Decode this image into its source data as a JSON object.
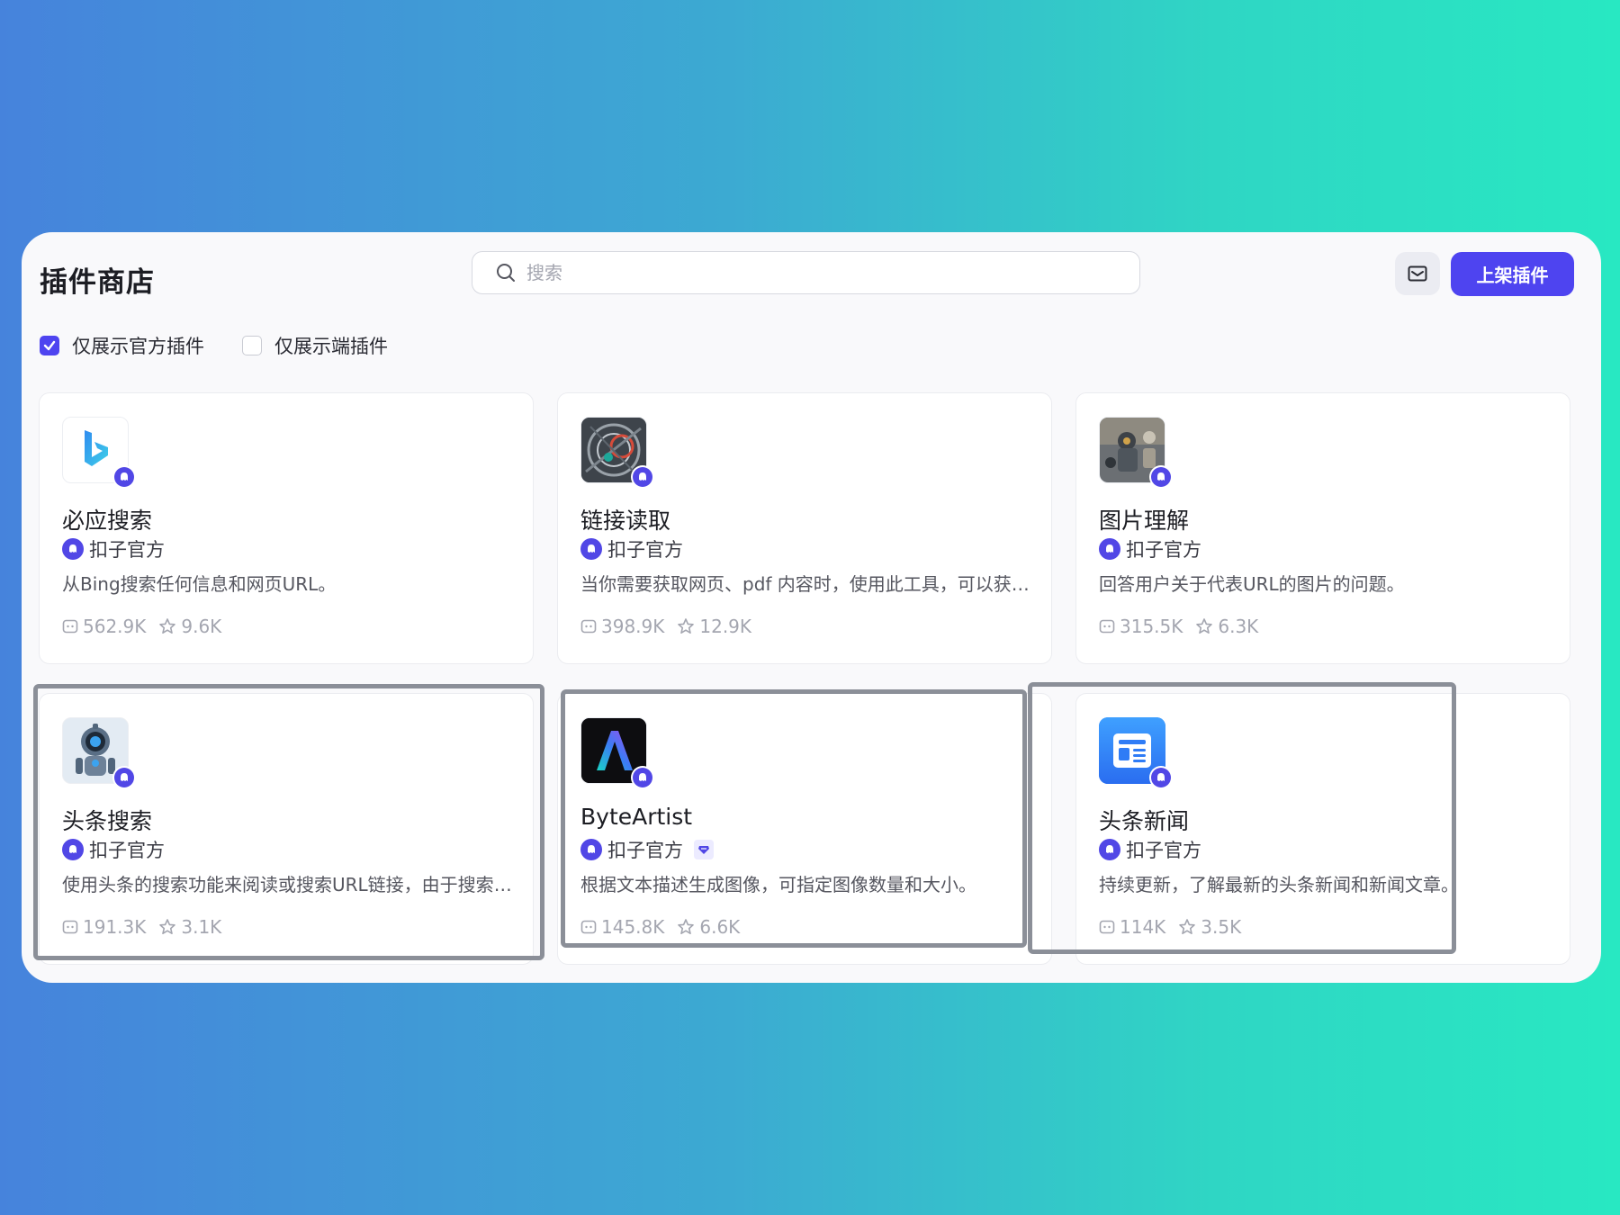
{
  "header": {
    "title": "插件商店",
    "search_placeholder": "搜索",
    "search_value": "",
    "publish_label": "上架插件"
  },
  "filters": [
    {
      "label": "仅展示官方插件",
      "checked": true
    },
    {
      "label": "仅展示端插件",
      "checked": false
    }
  ],
  "plugins": [
    {
      "name": "必应搜索",
      "author": "扣子官方",
      "description": "从Bing搜索任何信息和网页URL。",
      "uses": "562.9K",
      "stars": "9.6K",
      "icon": "bing-icon",
      "premium": false
    },
    {
      "name": "链接读取",
      "author": "扣子官方",
      "description": "当你需要获取网页、pdf 内容时，使用此工具，可以获取url链接下的标题和内容。",
      "uses": "398.9K",
      "stars": "12.9K",
      "icon": "link-reader-icon",
      "premium": false
    },
    {
      "name": "图片理解",
      "author": "扣子官方",
      "description": "回答用户关于代表URL的图片的问题。",
      "uses": "315.5K",
      "stars": "6.3K",
      "icon": "image-understanding-icon",
      "premium": false
    },
    {
      "name": "头条搜索",
      "author": "扣子官方",
      "description": "使用头条的搜索功能来阅读或搜索URL链接，由于搜索结果较多，请按需使用。",
      "uses": "191.3K",
      "stars": "3.1K",
      "icon": "robot-icon",
      "premium": false
    },
    {
      "name": "ByteArtist",
      "author": "扣子官方",
      "description": "根据文本描述生成图像，可指定图像数量和大小。",
      "uses": "145.8K",
      "stars": "6.6K",
      "icon": "byteartist-icon",
      "premium": true
    },
    {
      "name": "头条新闻",
      "author": "扣子官方",
      "description": "持续更新，了解最新的头条新闻和新闻文章。",
      "uses": "114K",
      "stars": "3.5K",
      "icon": "news-icon",
      "premium": false
    }
  ],
  "colors": {
    "accent": "#4e44f0",
    "highlight_border": "#8b8f98"
  }
}
